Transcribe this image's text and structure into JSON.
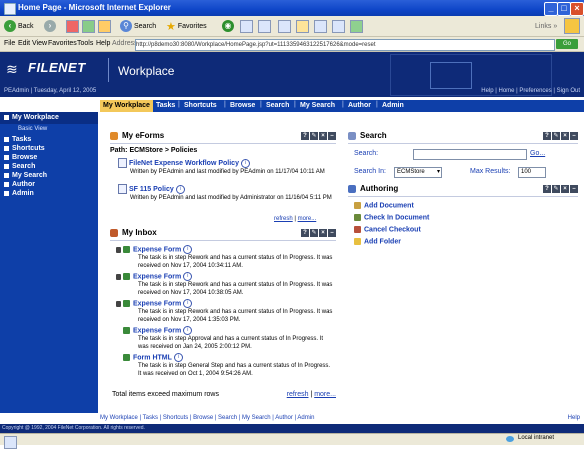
{
  "window": {
    "title": "Home Page - Microsoft Internet Explorer"
  },
  "toolbar": {
    "back": "Back",
    "search": "Search",
    "favorites": "Favorites",
    "links": "Links"
  },
  "menu": [
    "File",
    "Edit",
    "View",
    "Favorites",
    "Tools",
    "Help"
  ],
  "address": {
    "label": "Address",
    "url": "http://p8demo30:8080/Workplace/HomePage.jsp?ut=1113359463122517626&mode=reset",
    "go": "Go"
  },
  "header": {
    "brand": "FILENET",
    "app": "Workplace",
    "user": "PEAdmin | Tuesday, April 12, 2005",
    "links": "Help | Home | Preferences | Sign Out"
  },
  "tabs": [
    "My Workplace",
    "Tasks",
    "Shortcuts",
    "Browse",
    "Search",
    "My Search",
    "Author",
    "Admin"
  ],
  "leftnav": {
    "heading": "My Workplace",
    "sub": "Basic View",
    "items": [
      "Tasks",
      "Shortcuts",
      "Browse",
      "Search",
      "My Search",
      "Author",
      "Admin"
    ]
  },
  "eforms": {
    "title": "My eForms",
    "path": "Path: ECMStore > Policies",
    "items": [
      {
        "name": "FileNet Expense Workflow Policy",
        "desc": "Written by PEAdmin and last modified by PEAdmin on 11/17/04 10:11 AM"
      },
      {
        "name": "SF 115 Policy",
        "desc": "Written by PEAdmin and last modified by Administrator on 11/16/04 5:11 PM"
      }
    ],
    "refresh": "refresh",
    "more": "more..."
  },
  "inbox": {
    "title": "My Inbox",
    "items": [
      {
        "name": "Expense Form",
        "desc": "The task is in step Rework and has a current status of In Progress. It was received on Nov 17, 2004 10:34:11 AM."
      },
      {
        "name": "Expense Form",
        "desc": "The task is in step Rework and has a current status of In Progress. It was received on Nov 17, 2004 10:38:05 AM."
      },
      {
        "name": "Expense Form",
        "desc": "The task is in step Rework and has a current status of In Progress. It was received on Nov 17, 2004 1:35:03 PM."
      },
      {
        "name": "Expense Form",
        "desc": "The task is in step Approval and has a current status of In Progress. It was received on Jan 24, 2005 2:00:12 PM."
      },
      {
        "name": "Form HTML",
        "desc": "The task is in step General Step and has a current status of In Progress. It was received on Oct 1, 2004 9:54:26 AM."
      }
    ],
    "total": "Total items exceed maximum rows",
    "refresh": "refresh",
    "more": "more..."
  },
  "search": {
    "title": "Search",
    "search_label": "Search:",
    "go": "Go...",
    "search_in_label": "Search In:",
    "search_in_value": "ECMStore",
    "max_label": "Max Results:",
    "max_value": "100"
  },
  "authoring": {
    "title": "Authoring",
    "actions": [
      "Add Document",
      "Check In Document",
      "Cancel Checkout",
      "Add Folder"
    ]
  },
  "footer": {
    "nav": "My Workplace | Tasks | Shortcuts | Browse | Search | My Search | Author | Admin",
    "help": "Help",
    "copyright": "Copyright @ 1992, 2004 FileNet Corporation. All rights reserved.",
    "status_zone": "Local intranet"
  }
}
